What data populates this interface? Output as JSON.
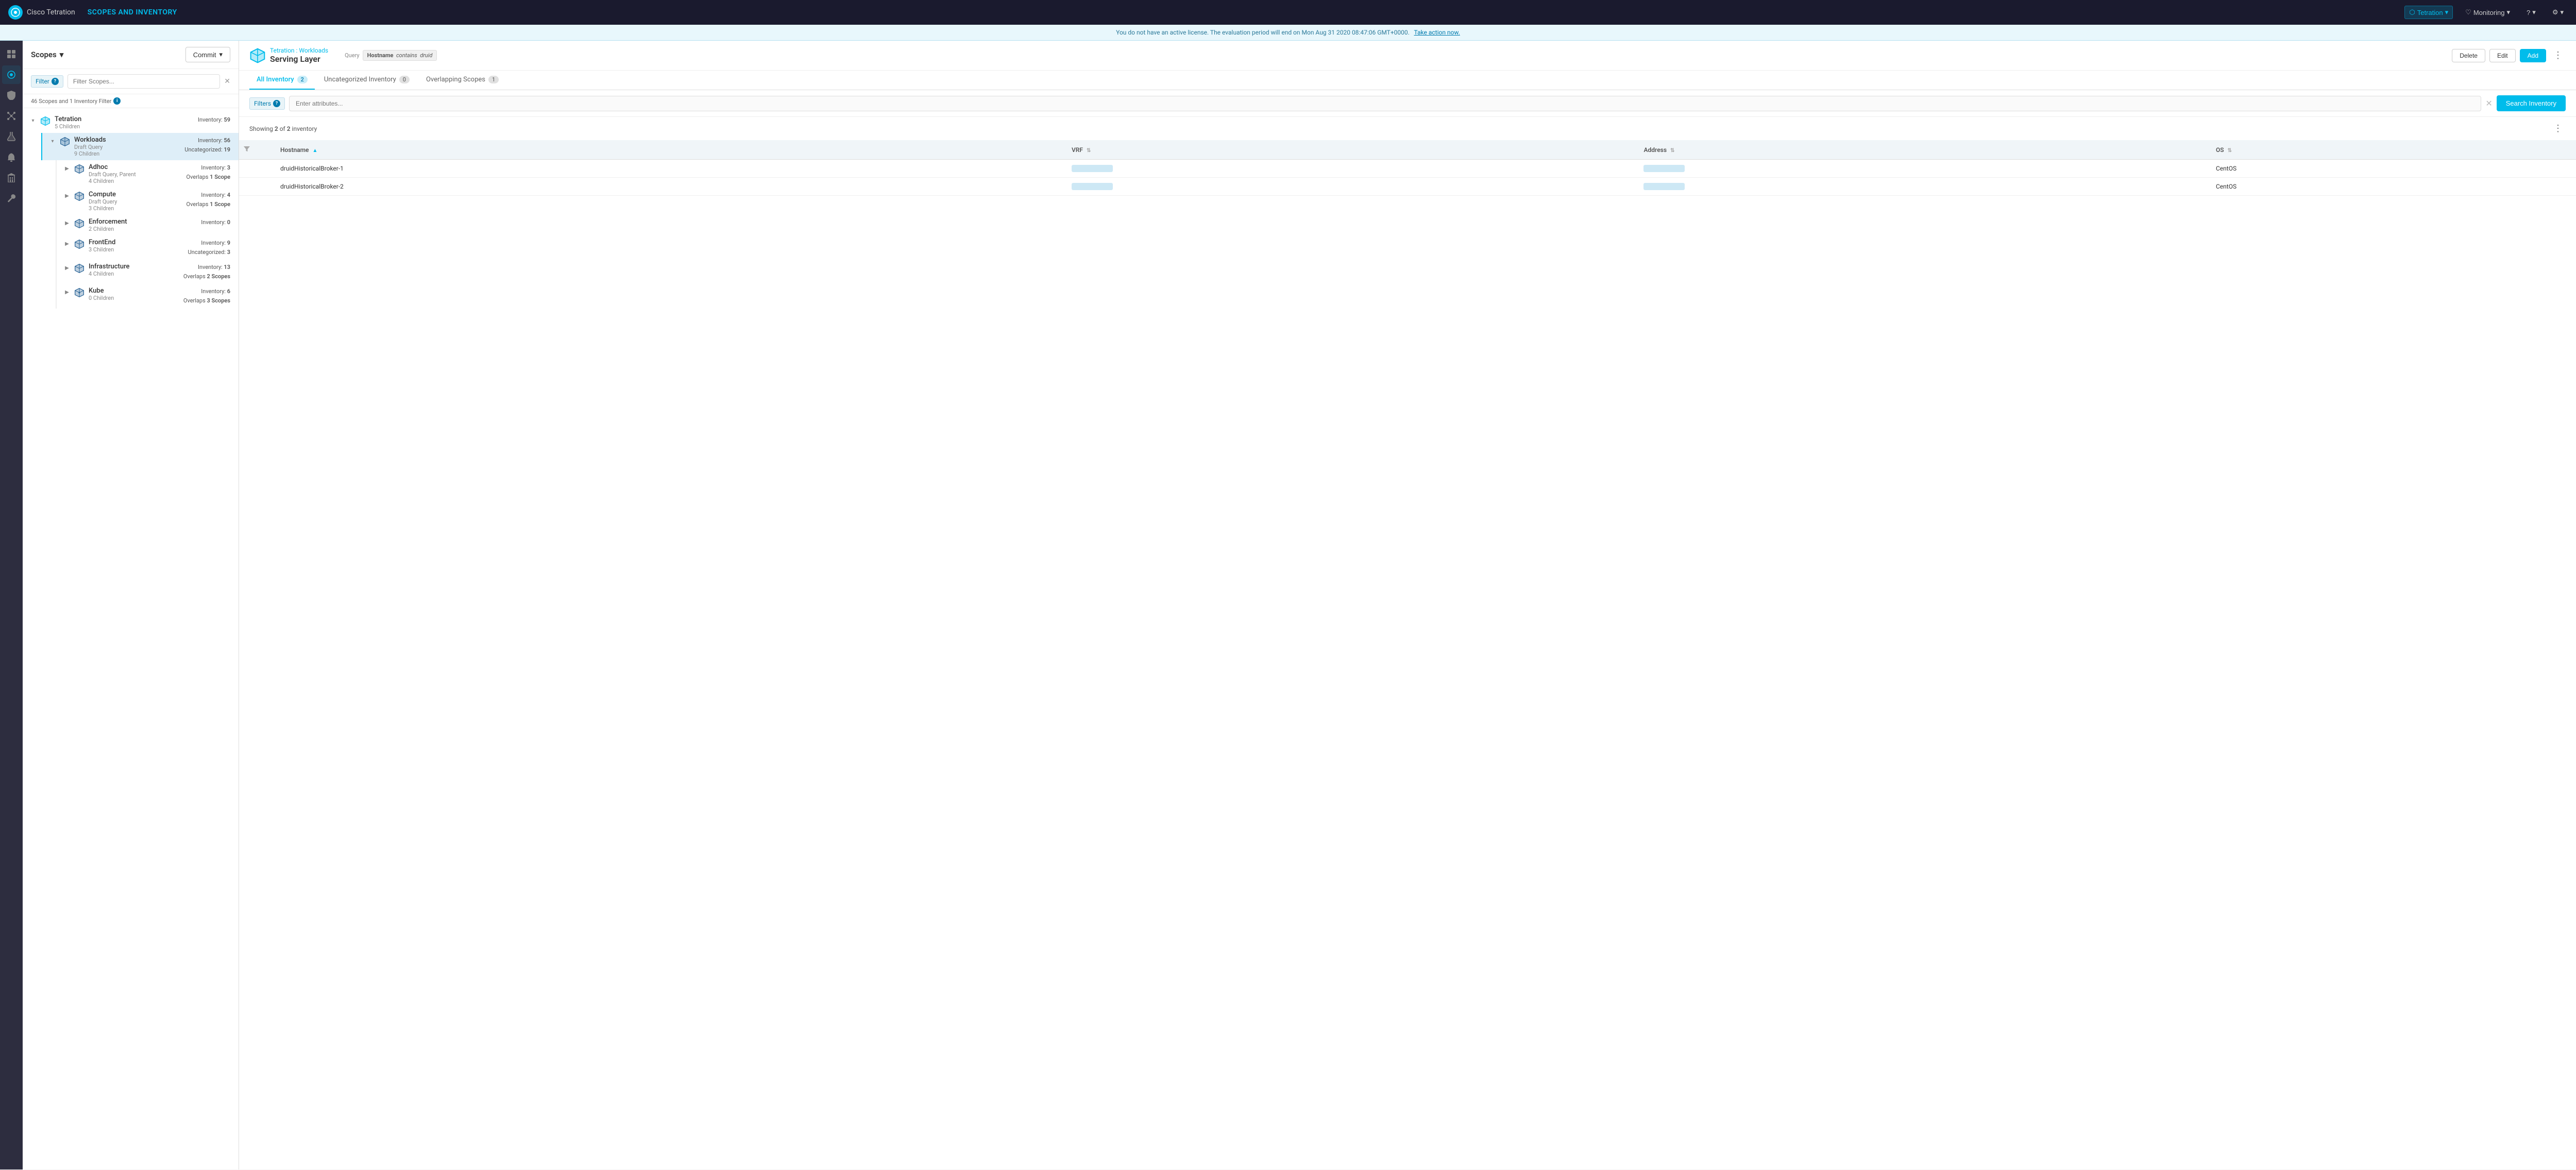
{
  "app": {
    "logo_text": "Cisco Tetration",
    "page_title": "SCOPES AND INVENTORY"
  },
  "nav": {
    "tenant_btn": "Tetration",
    "monitoring_btn": "Monitoring",
    "help_btn": "?",
    "settings_btn": "⚙"
  },
  "license_banner": {
    "text": "You do not have an active license. The evaluation period will end on Mon Aug 31 2020 08:47:06 GMT+0000.",
    "action": "Take action now."
  },
  "scopes_panel": {
    "title": "Scopes",
    "commit_btn": "Commit",
    "filter_label": "Filter",
    "filter_placeholder": "Filter Scopes...",
    "info_text": "46 Scopes and 1 Inventory Filter",
    "scopes": [
      {
        "name": "Tetration",
        "sub": "5 Children",
        "inventory": "59",
        "expanded": true,
        "children": [
          {
            "name": "Workloads",
            "sub": "Draft Query",
            "sub2": "9 Children",
            "inventory": "56",
            "uncategorized": "19",
            "selected": true,
            "expanded": true,
            "children": [
              {
                "name": "Adhoc",
                "sub": "Draft Query, Parent",
                "sub2": "4 Children",
                "inventory": "3",
                "overlaps": "1 Scope",
                "expanded": false
              },
              {
                "name": "Compute",
                "sub": "Draft Query",
                "sub2": "3 Children",
                "inventory": "4",
                "overlaps": "1 Scope",
                "expanded": false
              },
              {
                "name": "Enforcement",
                "sub": "2 Children",
                "inventory": "0",
                "expanded": false
              },
              {
                "name": "FrontEnd",
                "sub": "3 Children",
                "inventory": "9",
                "uncategorized": "3",
                "expanded": false
              },
              {
                "name": "Infrastructure",
                "sub": "4 Children",
                "inventory": "13",
                "overlaps": "2 Scopes",
                "expanded": false
              },
              {
                "name": "Kube",
                "sub": "0 Children",
                "inventory": "6",
                "overlaps": "3 Scopes",
                "expanded": false
              }
            ]
          }
        ]
      }
    ]
  },
  "content": {
    "breadcrumb": "Tetration : Workloads",
    "scope_title": "Serving Layer",
    "query_label": "Query",
    "query_text": "Hostname contains druid",
    "query_field": "Hostname",
    "query_op": "contains",
    "query_val": "druid",
    "actions": {
      "delete": "Delete",
      "edit": "Edit",
      "add": "Add"
    },
    "tabs": [
      {
        "label": "All Inventory",
        "count": "2",
        "active": true
      },
      {
        "label": "Uncategorized Inventory",
        "count": "0",
        "active": false
      },
      {
        "label": "Overlapping Scopes",
        "count": "1",
        "active": false
      }
    ],
    "filters": {
      "label": "Filters",
      "placeholder": "Enter attributes...",
      "search_btn": "Search Inventory"
    },
    "showing": {
      "prefix": "Showing",
      "current": "2",
      "separator": "of",
      "total": "2",
      "suffix": "inventory"
    },
    "table": {
      "columns": [
        {
          "label": "Hostname",
          "sortable": true,
          "sorted": true,
          "sort_dir": "asc"
        },
        {
          "label": "VRF",
          "sortable": true
        },
        {
          "label": "Address",
          "sortable": true
        },
        {
          "label": "OS",
          "sortable": true
        }
      ],
      "rows": [
        {
          "hostname": "druidHistoricalBroker-1",
          "vrf": "redacted",
          "address": "redacted",
          "os": "CentOS"
        },
        {
          "hostname": "druidHistoricalBroker-2",
          "vrf": "redacted",
          "address": "redacted",
          "os": "CentOS"
        }
      ]
    }
  }
}
